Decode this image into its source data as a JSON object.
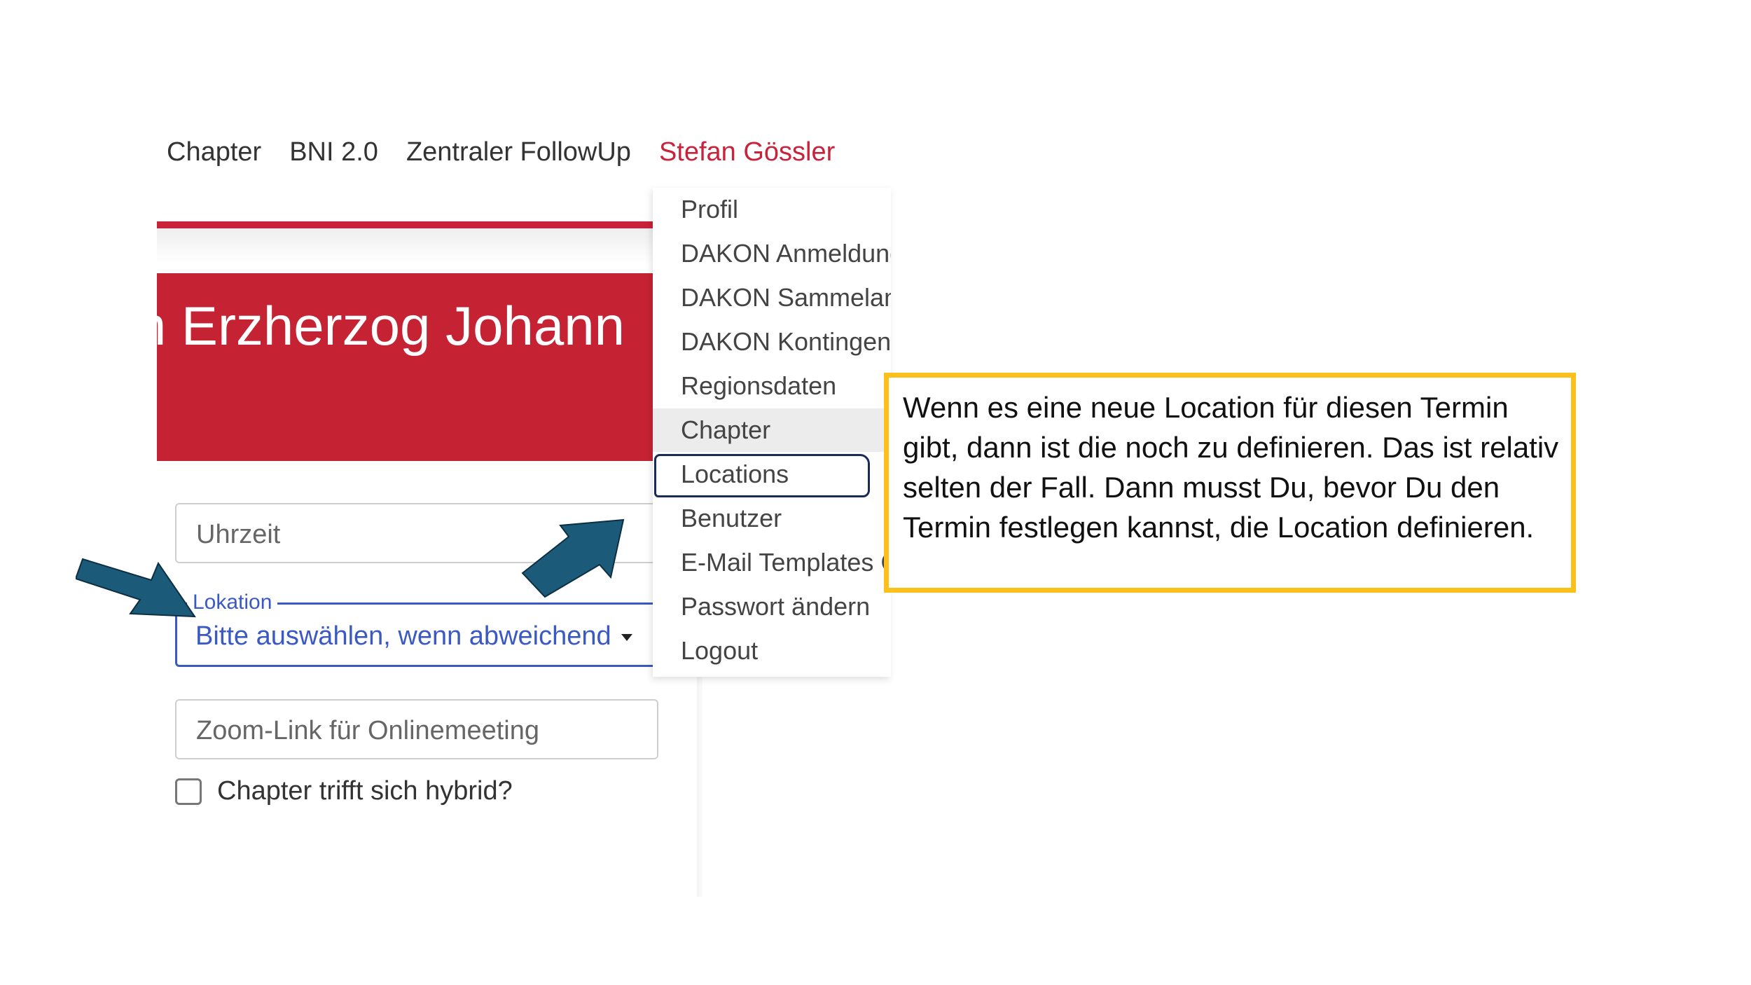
{
  "nav": {
    "items": [
      "Chapter",
      "BNI 2.0",
      "Zentraler FollowUp"
    ],
    "user": "Stefan Gössler"
  },
  "banner": {
    "title": "n Erzherzog Johann"
  },
  "form": {
    "time_placeholder": "Uhrzeit",
    "location_label": "Lokation",
    "location_value": "Bitte auswählen, wenn abweichend",
    "zoom_placeholder": "Zoom-Link für Onlinemeeting",
    "hybrid_label": "Chapter trifft sich hybrid?"
  },
  "dropdown": {
    "items": [
      "Profil",
      "DAKON Anmeldung",
      "DAKON Sammelanmeldung",
      "DAKON Kontingente",
      "Regionsdaten",
      "Chapter",
      "Locations",
      "Benutzer",
      "E-Mail Templates C",
      "Passwort ändern",
      "Logout"
    ],
    "active_index": 5,
    "circled_index": 6
  },
  "callout": {
    "text": "Wenn es eine neue Location für diesen Termin gibt, dann ist die noch zu definieren. Das ist relativ selten der Fall. Dann musst Du, bevor Du den Termin festlegen kannst, die Location definieren."
  },
  "colors": {
    "brand_red": "#c52334",
    "select_blue": "#3b59c2",
    "arrow_fill": "#1c5a7a",
    "callout_border": "#fbc11a"
  }
}
